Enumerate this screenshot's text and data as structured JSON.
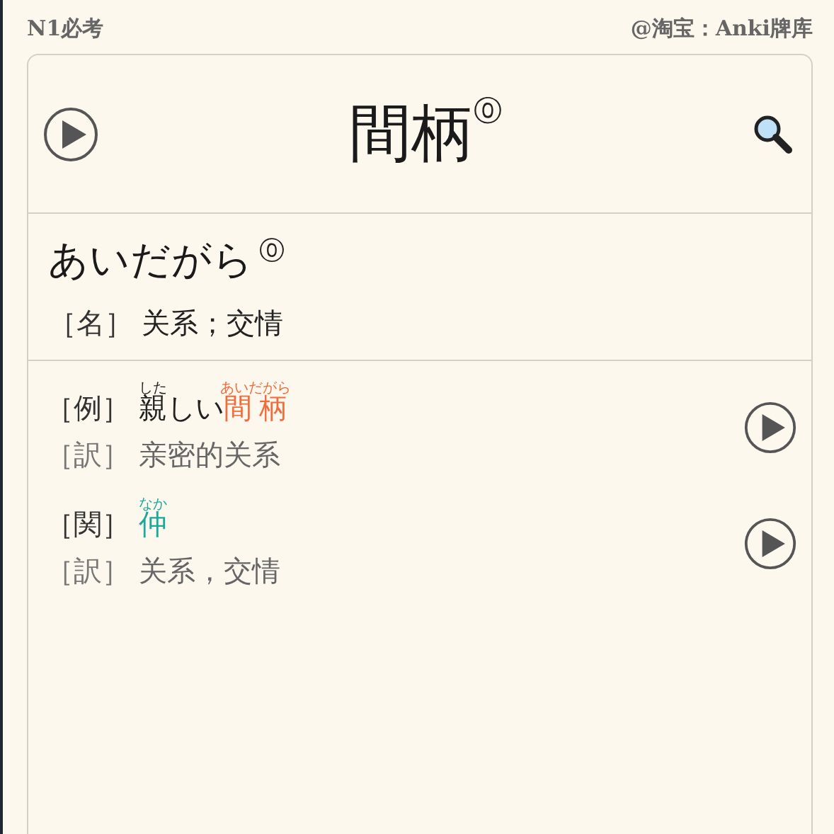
{
  "header": {
    "deck": "N1必考",
    "source": "@淘宝：Anki牌库"
  },
  "word": {
    "text": "間柄",
    "accent": "⓪"
  },
  "reading": {
    "text": "あいだがら",
    "accent": "⓪"
  },
  "definition": {
    "tag": "［名］",
    "text": "关系；交情"
  },
  "entries": [
    {
      "tag": "［例］",
      "segments": [
        {
          "text": "親",
          "ruby": "した",
          "color": "#222222"
        },
        {
          "text": "しい",
          "color": "#222222"
        },
        {
          "text": "間柄",
          "ruby": "あいだがら",
          "color": "#f26b3a"
        }
      ],
      "trans_tag": "［訳］",
      "translation": "亲密的关系"
    },
    {
      "tag": "［関］",
      "segments": [
        {
          "text": "仲",
          "ruby": "なか",
          "color": "#1aa99a"
        }
      ],
      "trans_tag": "［訳］",
      "translation": "关系，交情"
    }
  ]
}
